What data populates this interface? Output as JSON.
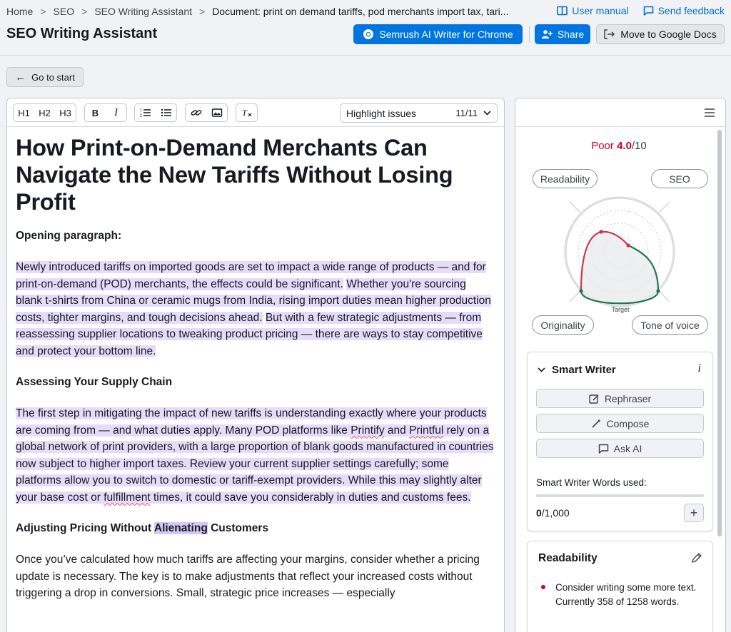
{
  "breadcrumbs": [
    "Home",
    "SEO",
    "SEO Writing Assistant",
    "Document: print on demand tariffs, pod merchants import tax, tari..."
  ],
  "header": {
    "user_manual": "User manual",
    "send_feedback": "Send feedback",
    "title": "SEO Writing Assistant",
    "chrome_button": "Semrush AI Writer for Chrome",
    "share_button": "Share",
    "move_button": "Move to Google Docs"
  },
  "go_to_start": "Go to start",
  "toolbar": {
    "h1": "H1",
    "h2": "H2",
    "h3": "H3",
    "bold": "B",
    "italic": "I",
    "highlight_label": "Highlight issues",
    "highlight_count": "11/11"
  },
  "document": {
    "title": "How Print-on-Demand Merchants Can Navigate the New Tariffs Without Losing Profit",
    "h_opening": "Opening paragraph:",
    "p1_a": "Newly introduced tariffs on imported goods are set to impact a wide range of products — and for print-on-demand (POD) merchants, the effects could be significant.",
    "p1_b": "Whether you're sourcing blank t-shirts from China or ceramic mugs from India, rising import duties mean higher production costs, tighter margins, and tough decisions ahead.",
    "p1_c": "But with a few strategic adjustments — from reassessing supplier locations to tweaking product pricing — there are ways to stay competitive and protect your bottom line.",
    "h_supply": "Assessing Your Supply Chain",
    "p2_a": "The first step in mitigating the impact of new tariffs is understanding exactly where your products are coming from — and what duties apply. Many POD platforms like ",
    "p2_printify": "Printify",
    "p2_and": " and ",
    "p2_printful": "Printful",
    "p2_b": " rely on a global network of print providers, with a large proportion of blank goods manufactured in countries now subject to higher import taxes. Review your current supplier settings carefully; some platforms allow you to switch to domestic or tariff-exempt providers. While this may slightly alter your base cost or ",
    "p2_fulfillment": "fulfillment",
    "p2_c": " times, it could save you considerably in duties and customs fees.",
    "h_pricing_a": "Adjusting Pricing Without ",
    "h_pricing_b": "Alienating",
    "h_pricing_c": " Customers",
    "p3": "Once you’ve calculated how much tariffs are affecting your margins, consider whether a pricing update is necessary. The key is to make adjustments that reflect your increased costs without triggering a drop in conversions. Small, strategic price increases — especially"
  },
  "panel": {
    "score_label": "Poor",
    "score_value": "4.0",
    "score_max": "/10",
    "readability_pill": "Readability",
    "seo_pill": "SEO",
    "originality_pill": "Originality",
    "tone_pill": "Tone of voice",
    "target_label": "Target",
    "smart_writer": {
      "title": "Smart Writer",
      "rephraser": "Rephraser",
      "compose": "Compose",
      "ask_ai": "Ask AI",
      "words_used_label": "Smart Writer Words used:",
      "words_used": "0",
      "words_limit": "/1,000",
      "words_used_fraction": 0
    },
    "readability": {
      "title": "Readability",
      "issue": "Consider writing some more text. Currently 358 of 1258 words."
    }
  },
  "colors": {
    "accent": "#0075e0",
    "poor": "#d1002f",
    "highlight": "#e5dcfa",
    "chart_red": "#d1334a",
    "chart_green": "#1a7a4c"
  }
}
